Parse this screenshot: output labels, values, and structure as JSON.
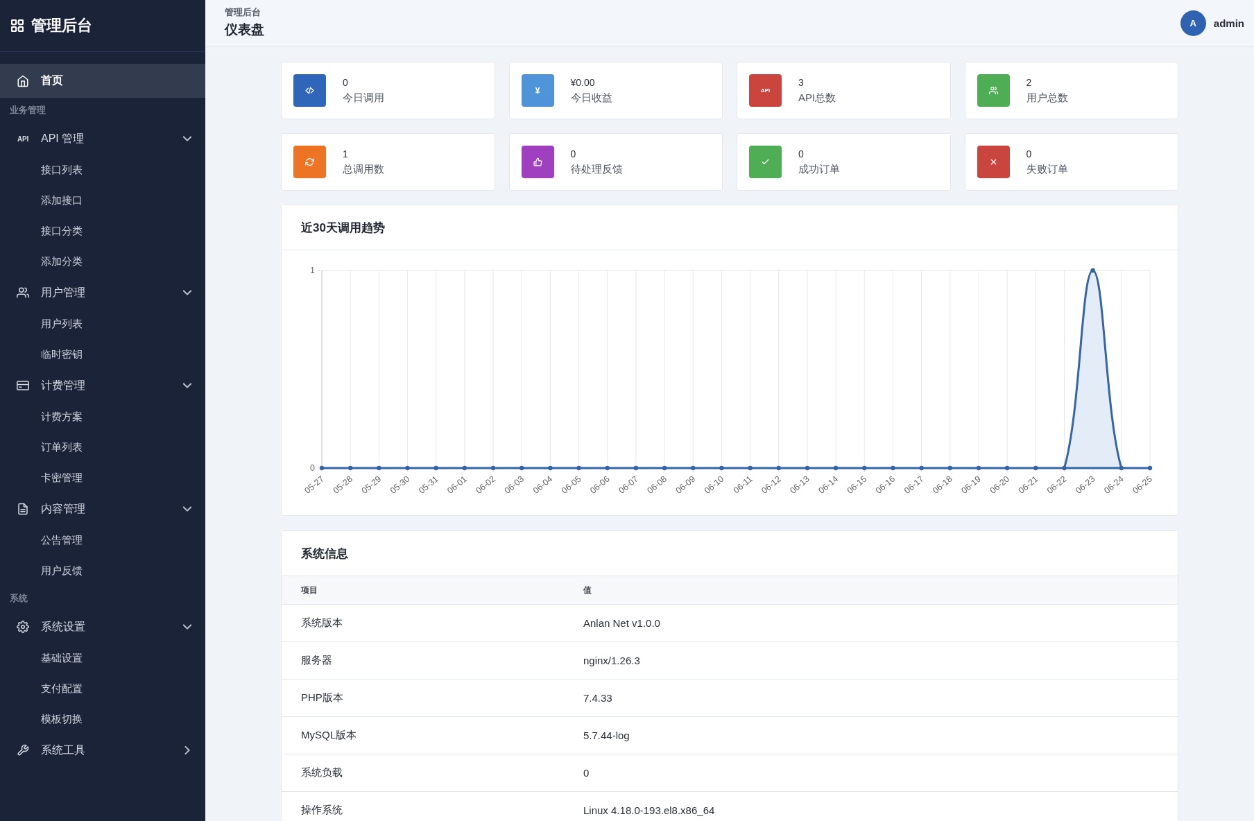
{
  "sidebar": {
    "title": "管理后台",
    "nav": [
      {
        "kind": "link",
        "label": "首页",
        "selected": true
      },
      {
        "kind": "section",
        "label": "业务管理"
      },
      {
        "kind": "group",
        "label": "API 管理",
        "icon_text": "API",
        "selected": false,
        "expanded": true,
        "children": [
          {
            "label": "接口列表",
            "selected": false
          },
          {
            "label": "添加接口",
            "selected": false
          },
          {
            "label": "接口分类",
            "selected": false
          },
          {
            "label": "添加分类",
            "selected": false
          }
        ]
      },
      {
        "kind": "group",
        "label": "用户管理",
        "selected": false,
        "expanded": true,
        "children": [
          {
            "label": "用户列表",
            "selected": false
          },
          {
            "label": "临时密钥",
            "selected": false
          }
        ]
      },
      {
        "kind": "group",
        "label": "计费管理",
        "selected": false,
        "expanded": true,
        "children": [
          {
            "label": "计费方案",
            "selected": false
          },
          {
            "label": "订单列表",
            "selected": false
          },
          {
            "label": "卡密管理",
            "selected": false
          }
        ]
      },
      {
        "kind": "group",
        "label": "内容管理",
        "selected": false,
        "expanded": true,
        "children": [
          {
            "label": "公告管理",
            "selected": false
          },
          {
            "label": "用户反馈",
            "selected": false
          }
        ]
      },
      {
        "kind": "section",
        "label": "系统"
      },
      {
        "kind": "group",
        "label": "系统设置",
        "selected": false,
        "expanded": true,
        "children": [
          {
            "label": "基础设置",
            "selected": false
          },
          {
            "label": "支付配置",
            "selected": false
          },
          {
            "label": "模板切换",
            "selected": false
          }
        ]
      },
      {
        "kind": "group",
        "label": "系统工具",
        "selected": false,
        "expanded": false
      }
    ]
  },
  "header": {
    "breadcrumb": "管理后台",
    "title": "仪表盘",
    "user": {
      "initial": "A",
      "name": "admin"
    }
  },
  "stats": [
    {
      "value": "0",
      "label": "今日调用",
      "color": "#2f66b9"
    },
    {
      "value": "¥0.00",
      "label": "今日收益",
      "color": "#4f93d8",
      "icon_text": "¥"
    },
    {
      "value": "3",
      "label": "API总数",
      "color": "#c9453d",
      "icon_text": "API"
    },
    {
      "value": "2",
      "label": "用户总数",
      "color": "#4fae55"
    },
    {
      "value": "1",
      "label": "总调用数",
      "color": "#ec7424"
    },
    {
      "value": "0",
      "label": "待处理反馈",
      "color": "#a040c0"
    },
    {
      "value": "0",
      "label": "成功订单",
      "color": "#4fae55"
    },
    {
      "value": "0",
      "label": "失败订单",
      "color": "#c9453d"
    }
  ],
  "trend": {
    "title": "近30天调用趋势",
    "chart_data": {
      "type": "area",
      "categories": [
        "05-27",
        "05-28",
        "05-29",
        "05-30",
        "05-31",
        "06-01",
        "06-02",
        "06-03",
        "06-04",
        "06-05",
        "06-06",
        "06-07",
        "06-08",
        "06-09",
        "06-10",
        "06-11",
        "06-12",
        "06-13",
        "06-14",
        "06-15",
        "06-16",
        "06-17",
        "06-18",
        "06-19",
        "06-20",
        "06-21",
        "06-22",
        "06-23",
        "06-24",
        "06-25"
      ],
      "series": [
        {
          "color": "#3465a8",
          "values": [
            0,
            0,
            0,
            0,
            0,
            0,
            0,
            0,
            0,
            0,
            0,
            0,
            0,
            0,
            0,
            0,
            0,
            0,
            0,
            0,
            0,
            0,
            0,
            0,
            0,
            0,
            0,
            1,
            0,
            0
          ]
        }
      ],
      "ylim": [
        0,
        1
      ],
      "yticks": [
        0,
        1
      ],
      "grid": true
    }
  },
  "system_info": {
    "title": "系统信息",
    "columns": [
      "项目",
      "值"
    ],
    "rows": [
      [
        "系统版本",
        "Anlan Net v1.0.0"
      ],
      [
        "服务器",
        "nginx/1.26.3"
      ],
      [
        "PHP版本",
        "7.4.33"
      ],
      [
        "MySQL版本",
        "5.7.44-log"
      ],
      [
        "系统负载",
        "0"
      ],
      [
        "操作系统",
        "Linux 4.18.0-193.el8.x86_64"
      ]
    ]
  }
}
